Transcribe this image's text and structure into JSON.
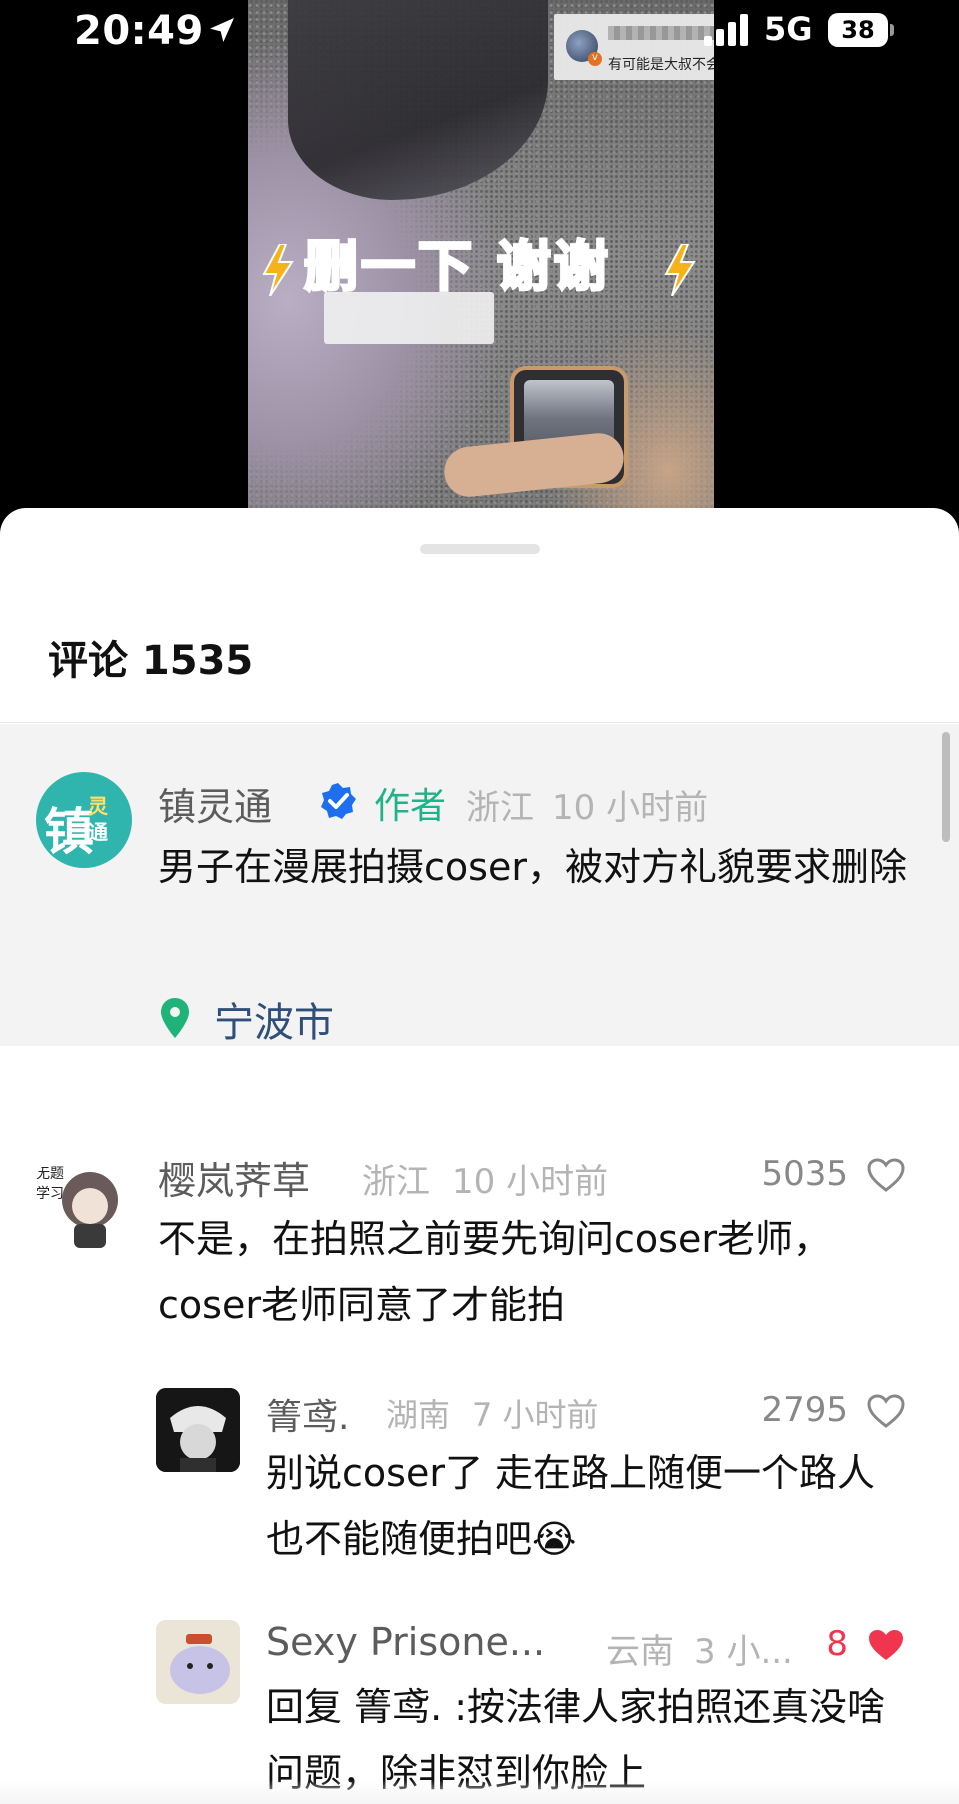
{
  "status_bar": {
    "time": "20:49",
    "network": "5G",
    "battery": "38",
    "location_icon": "location-arrow-icon",
    "signal_icon": "cellular-signal-icon"
  },
  "video": {
    "caption_text": "有可能是大叔不会用美颜相机",
    "overlay_title": "删一下 谢谢"
  },
  "comments_panel": {
    "title": "评论 1535",
    "pinned": {
      "author": "镇灵通",
      "author_badge": "作者",
      "region": "浙江",
      "time": "10 小时前",
      "text": "男子在漫展拍摄coser，被对方礼貌要求删除",
      "location": "宁波市",
      "avatar_text": "镇灵通"
    },
    "comments": [
      {
        "author": "樱岚荠草",
        "region": "浙江",
        "time": "10 小时前",
        "likes": "5035",
        "text": "不是，在拍照之前要先询问coser老师，coser老师同意了才能拍"
      }
    ],
    "replies": [
      {
        "author": "箐鸢.",
        "region": "湖南",
        "time": "7 小时前",
        "likes": "2795",
        "text": "别说coser了 走在路上随便一个路人也不能随便拍吧",
        "emoji": "😭"
      },
      {
        "author": "Sexy Prisone...",
        "region": "云南",
        "time": "3 小...",
        "likes": "8",
        "text": "回复 箐鸢. :按法律人家拍照还真没啥问题，除非怼到你脸上",
        "liked": true
      }
    ]
  },
  "colors": {
    "author_badge": "#1fb38a",
    "verified": "#1e6ff0",
    "liked_heart": "#f1354f",
    "location_text": "#2f4f7a"
  }
}
